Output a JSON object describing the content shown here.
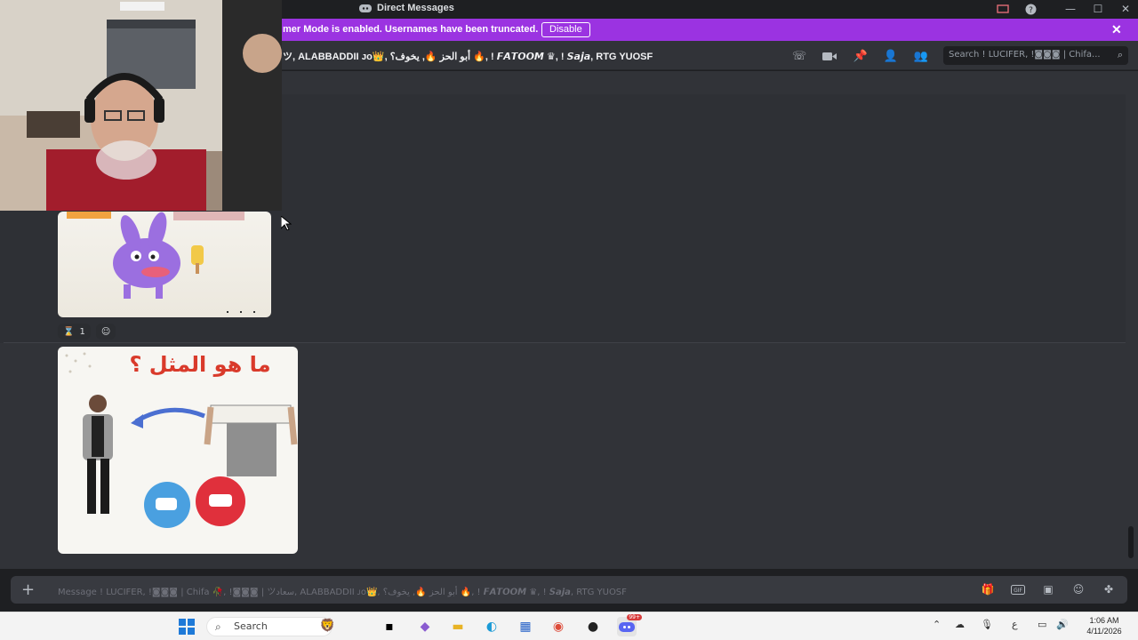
{
  "window": {
    "title": "Direct Messages"
  },
  "banner": {
    "message": "mer Mode is enabled. Usernames have been truncated.",
    "disable_label": "Disable"
  },
  "header": {
    "participants": "ツ, ALABBADDII ᴊᴏ👑, أبو الحز 🔥, يخوف؟ 🔥, ! 𝙁𝘼𝙏𝙊𝙊𝙈 ♛, ! 𝙎𝙖𝙟𝙖, RTG YUOSF",
    "search_placeholder": "Search ! LUCIFER, !◙◙◙ | Chifa..."
  },
  "chat": {
    "reaction": {
      "emoji": "⌛",
      "count": "1"
    },
    "image2_caption": "ما هو المثل ؟"
  },
  "composer": {
    "placeholder": "Message ! LUCIFER, !◙◙◙ | Chifa 🥀, !◙◙◙ | ツسعاد, ALABBADDII ᴊᴏ👑, أبو الحز 🔥, يخوف؟ 🔥, ! 𝙁𝘼𝙏𝙊𝙊𝙈 ♛, ! 𝙎𝙖𝙟𝙖, RTG YUOSF"
  },
  "taskbar": {
    "search_label": "Search",
    "time": "1:06 AM",
    "date": "4/11/2026",
    "lang": "ع",
    "discord_badge": "99+"
  },
  "colors": {
    "banner": "#9b33e1",
    "chat_bg": "#313338",
    "titlebar_bg": "#1e1f22",
    "composer_bg": "#383a40",
    "taskbar_bg": "#f3f3f3"
  }
}
